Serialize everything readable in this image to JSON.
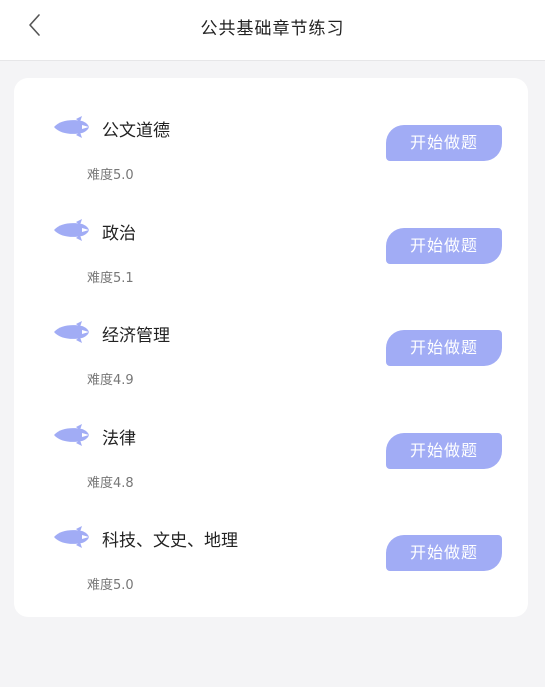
{
  "header": {
    "title": "公共基础章节练习",
    "back_icon": "chevron-left-icon"
  },
  "colors": {
    "accent": "#a1acf5",
    "page_bg": "#f4f4f6",
    "card_bg": "#ffffff"
  },
  "chapters": [
    {
      "name": "公文道德",
      "difficulty": "难度5.0",
      "button_label": "开始做题",
      "icon": "rocket-icon"
    },
    {
      "name": "政治",
      "difficulty": "难度5.1",
      "button_label": "开始做题",
      "icon": "rocket-icon"
    },
    {
      "name": "经济管理",
      "difficulty": "难度4.9",
      "button_label": "开始做题",
      "icon": "rocket-icon"
    },
    {
      "name": "法律",
      "difficulty": "难度4.8",
      "button_label": "开始做题",
      "icon": "rocket-icon"
    },
    {
      "name": "科技、文史、地理",
      "difficulty": "难度5.0",
      "button_label": "开始做题",
      "icon": "rocket-icon"
    }
  ]
}
